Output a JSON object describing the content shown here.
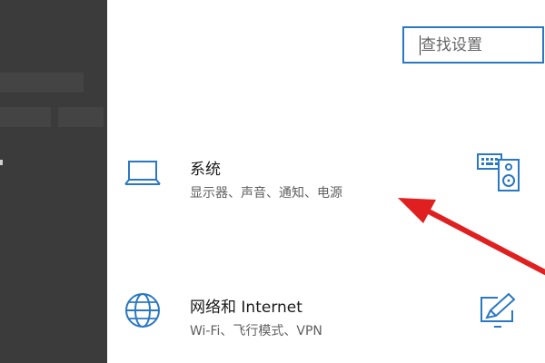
{
  "search": {
    "placeholder": "查找设置"
  },
  "categories": [
    {
      "title": "系统",
      "description": "显示器、声音、通知、电源",
      "icon": "laptop-icon"
    },
    {
      "title": "网络和 Internet",
      "description": "Wi-Fi、飞行模式、VPN",
      "icon": "globe-icon"
    },
    {
      "title": "",
      "description": "",
      "icon": "keyboard-speaker-icon"
    },
    {
      "title": "",
      "description": "",
      "icon": "pen-tablet-icon"
    }
  ],
  "colors": {
    "accent": "#2b78c2",
    "sidebar": "#3b3b3b",
    "annotation_arrow": "#e02020"
  }
}
